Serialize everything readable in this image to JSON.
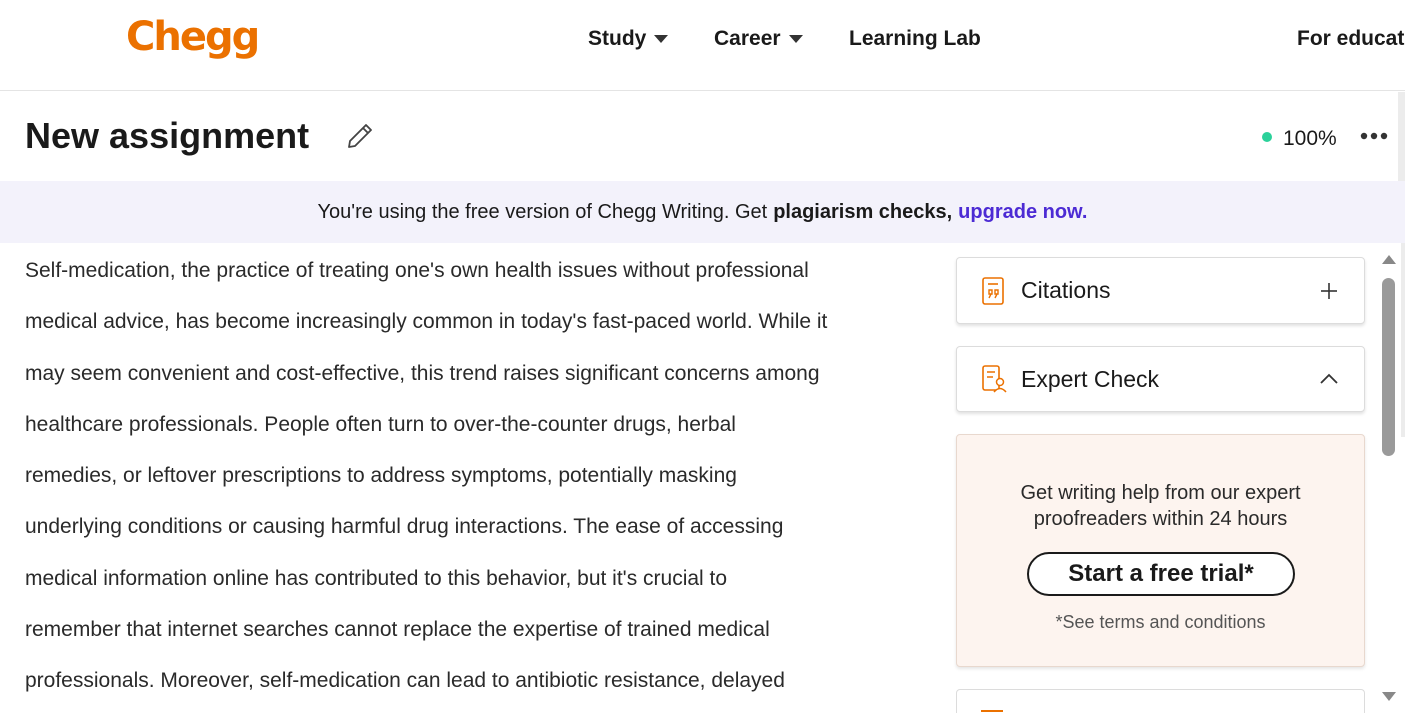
{
  "nav": {
    "logo": "Chegg",
    "items": [
      {
        "label": "Study",
        "has_caret": true
      },
      {
        "label": "Career",
        "has_caret": true
      },
      {
        "label": "Learning Lab",
        "has_caret": false
      },
      {
        "label": "For educato",
        "has_caret": false
      }
    ]
  },
  "doc": {
    "title": "New assignment",
    "zoom": "100%",
    "status_color": "#2bd19a"
  },
  "banner": {
    "text": "You're using the free version of Chegg Writing. Get",
    "bold": "plagiarism checks,",
    "link": "upgrade now."
  },
  "essay": {
    "lines": [
      "Self-medication, the practice of treating one's own health issues without professional",
      "medical advice, has become increasingly common in today's fast-paced world. While it",
      "may seem convenient and cost-effective, this trend raises significant concerns among",
      "healthcare professionals. People often turn to over-the-counter drugs, herbal",
      "remedies, or leftover prescriptions to address symptoms, potentially masking",
      "underlying conditions or causing harmful drug interactions. The ease of accessing",
      "medical information online has contributed to this behavior, but it's crucial to",
      "remember that internet searches cannot replace the expertise of trained medical",
      "professionals. Moreover, self-medication can lead to antibiotic resistance, delayed"
    ]
  },
  "panel": {
    "citations": {
      "title": "Citations",
      "icon": "citation-quote-icon",
      "action": "plus-icon"
    },
    "expert": {
      "title": "Expert Check",
      "icon": "expert-check-icon",
      "action": "chevron-up-icon"
    },
    "promo": {
      "line1": "Get writing help from our expert",
      "line2": "proofreaders within 24 hours",
      "button": "Start a free trial*",
      "terms": "*See terms and conditions"
    }
  },
  "colors": {
    "brand": "#eb7100",
    "link": "#4c2bd4",
    "banner_bg": "#f3f2fb",
    "promo_bg": "#fdf4ef"
  }
}
